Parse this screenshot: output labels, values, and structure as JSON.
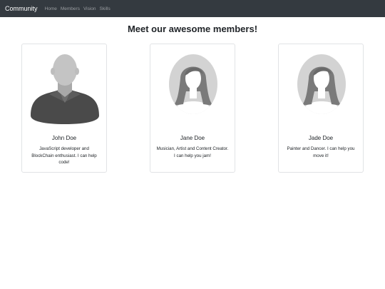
{
  "navbar": {
    "brand": "Community",
    "links": [
      "Home",
      "Members",
      "Vision",
      "Skills"
    ]
  },
  "page": {
    "heading": "Meet our awesome members!"
  },
  "members": [
    {
      "name": "John Doe",
      "bio": "JavaScript developer and BlockChain enthusiast. I can help code!",
      "avatar": "male-avatar-icon"
    },
    {
      "name": "Jane Doe",
      "bio": "Musician, Artist and Content Creator. I can help you jam!",
      "avatar": "female-avatar-icon"
    },
    {
      "name": "Jade Doe",
      "bio": "Painter and Dancer. I can help you move it!",
      "avatar": "female-avatar-icon"
    }
  ],
  "colors": {
    "navbar_bg": "#343a40",
    "brand_text": "#ffffff",
    "nav_link_text": "#9a9da1",
    "card_border": "#e1e3e5"
  }
}
